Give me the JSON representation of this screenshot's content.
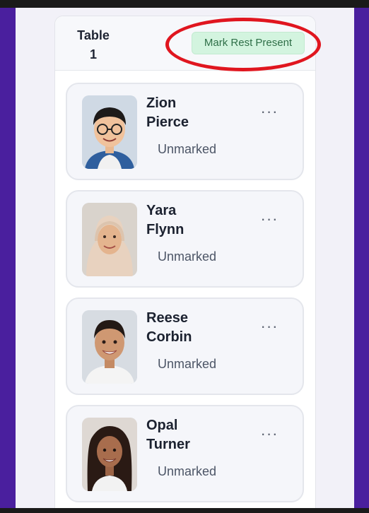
{
  "table": {
    "title": "Table 1",
    "mark_rest_present_label": "Mark Rest Present"
  },
  "students": [
    {
      "first": "Zion",
      "last": "Pierce",
      "status": "Unmarked",
      "more": "···"
    },
    {
      "first": "Yara",
      "last": "Flynn",
      "status": "Unmarked",
      "more": "···"
    },
    {
      "first": "Reese",
      "last": "Corbin",
      "status": "Unmarked",
      "more": "···"
    },
    {
      "first": "Opal",
      "last": "Turner",
      "status": "Unmarked",
      "more": "···"
    }
  ],
  "colors": {
    "page_background": "#4a1f9e",
    "button_background": "#d3f4df",
    "button_text": "#2f6f48",
    "annotation": "#e0161f"
  },
  "icons": [
    "more-options-icon"
  ]
}
